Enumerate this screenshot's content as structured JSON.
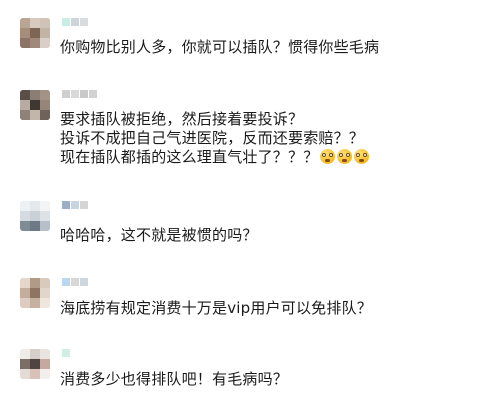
{
  "comments": [
    {
      "lines": [
        "你购物比别人多，你就可以插队？惯得你些毛病"
      ],
      "emoji_count": 0
    },
    {
      "lines": [
        "要求插队被拒绝，然后接着要投诉？",
        "投诉不成把自己气进医院，反而还要索赔？？",
        "现在插队都插的这么理直气壮了？？？"
      ],
      "emoji_count": 3
    },
    {
      "lines": [
        "哈哈哈，这不就是被惯的吗？"
      ],
      "emoji_count": 0
    },
    {
      "lines": [
        "海底捞有规定消费十万是vip用户可以免排队？"
      ],
      "emoji_count": 0
    },
    {
      "lines": [
        "消费多少也得排队吧！有毛病吗？"
      ],
      "emoji_count": 0
    }
  ],
  "emoji_icon": "dizzy-face-emoji",
  "colors": {
    "text": "#1a1a1a",
    "background": "#ffffff"
  }
}
